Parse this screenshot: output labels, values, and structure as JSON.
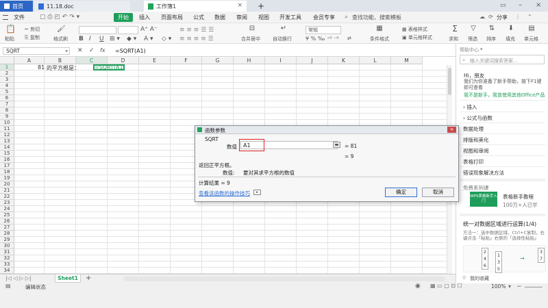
{
  "tabs": [
    {
      "label": "首页"
    },
    {
      "label": "11.18.doc"
    },
    {
      "label": "工作簿1"
    }
  ],
  "new_tab": "+",
  "menu": {
    "file": "文件",
    "items": [
      "开始",
      "插入",
      "页面布局",
      "公式",
      "数据",
      "审阅",
      "视图",
      "开发工具",
      "会员专享"
    ],
    "search": "查找功能、搜索模板",
    "share": "分享"
  },
  "toolbar": {
    "paste": "粘贴",
    "cut": "剪切",
    "copy": "复制",
    "format_painter": "格式刷",
    "merge_center": "合并居中",
    "wrap": "自动换行",
    "number_format": "常规",
    "table_style": "表格样式",
    "conditional": "条件格式",
    "cell_style": "单元格样式",
    "sum": "求和",
    "filter": "筛选",
    "sort": "排序",
    "fill": "填充",
    "cell": "单元格"
  },
  "formula_bar": {
    "name_box": "SQRT",
    "fx": "fx",
    "content": "=SQRT(A1)"
  },
  "columns": [
    "A",
    "B",
    "C",
    "D",
    "E",
    "F",
    "G",
    "H",
    "I",
    "J",
    "K",
    "L",
    "M"
  ],
  "rows": [
    "1",
    "2",
    "3",
    "4",
    "5",
    "6",
    "7",
    "8",
    "9",
    "10",
    "11",
    "12",
    "13",
    "14",
    "15",
    "16",
    "17",
    "18",
    "19",
    "20",
    "21",
    "22",
    "23",
    "24",
    "25",
    "26",
    "27",
    "28",
    "29",
    "30",
    "31",
    "32",
    "33",
    "34"
  ],
  "cells": {
    "a1": "81",
    "b1": "的平方根是：",
    "c1": "=SQRT(A1)"
  },
  "sheet": {
    "name": "Sheet1",
    "add": "+"
  },
  "status": {
    "mode": "编辑状态",
    "zoom": "100%"
  },
  "right_panel": {
    "header": "帮助中心",
    "search_placeholder": "输入关键词搜索答案...",
    "greeting": "Hi，朋友",
    "greeting_body": "我们为你准备了新手帮助，按下F1键即可查看",
    "new_user_link": "我不是新手，我曾使用其他Office产品",
    "categories": [
      "插入",
      "公式与函数",
      "数据处理",
      "排版和美化",
      "视图和审阅",
      "表格打印",
      "错误现象解决方法"
    ],
    "course_header": "免费系列课",
    "course_badge": "WPS表格新手入门",
    "course_title": "表格新手教程",
    "course_learners": "100万+人已学",
    "video_title": "统一对数据区域进行运算(1/4)",
    "video_desc": "方法一：选中数据区域，Ctrl+C复制，右键点击「粘贴」右侧的「选择性粘贴」",
    "video_nums_left": [
      "2",
      "4",
      "6"
    ],
    "video_nums_mid": [
      "1",
      "3",
      "5"
    ],
    "video_nums_right": [
      "3",
      "7"
    ],
    "favorites": "我的收藏"
  },
  "dialog": {
    "title": "函数参数",
    "function": "SQRT",
    "arg_label": "数值",
    "arg_value": "A1",
    "arg_result": "= 81",
    "result_preview": "= 9",
    "description": "返回正平方根。",
    "arg_desc_label": "数值:",
    "arg_desc": "要对其求平方根的数值",
    "calc_result": "计算结果 = 9",
    "help_link": "查看该函数的操作技巧",
    "ok": "确定",
    "cancel": "取消"
  },
  "colors": {
    "accent": "#1e9e5a",
    "highlight_red": "#e02020"
  }
}
